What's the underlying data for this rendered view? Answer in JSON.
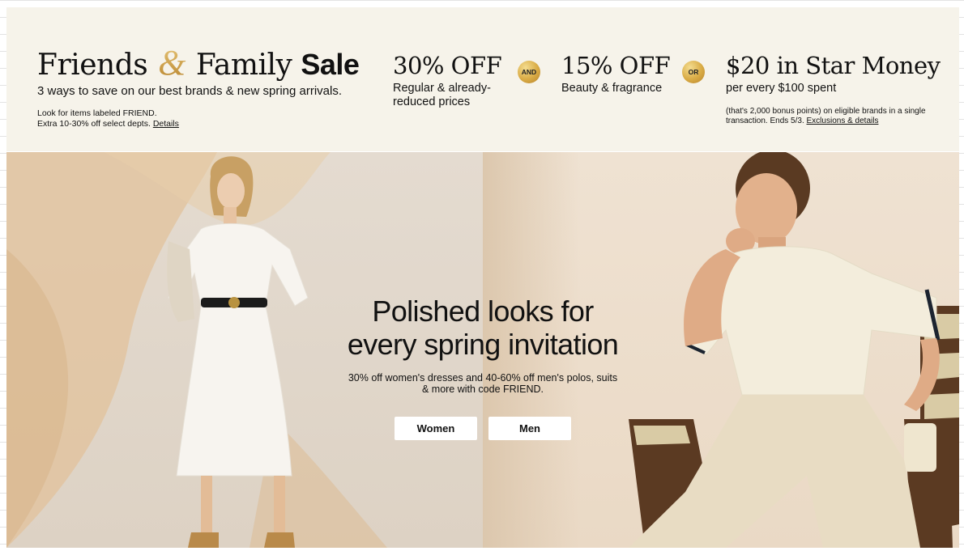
{
  "banner": {
    "title_part1": "Friends",
    "title_amp": "&",
    "title_part2": "Family",
    "title_sale": "Sale",
    "subtitle": "3 ways to save on our best brands & new spring arrivals.",
    "note_line1": "Look for items labeled FRIEND.",
    "note_line2": "Extra 10-30% off select depts.",
    "note_link": "Details",
    "offers": [
      {
        "headline": "30% OFF",
        "desc_line1": "Regular & already-",
        "desc_line2": "reduced prices"
      },
      {
        "headline": "15% OFF",
        "desc_line1": "Beauty & fragrance"
      },
      {
        "headline": "$20 in Star Money",
        "desc_line1": "per every $100 spent"
      }
    ],
    "coin_and": "AND",
    "coin_or": "OR",
    "fine_print": "(that's 2,000 bonus points) on eligible brands in a single transaction. Ends 5/3.",
    "fine_link": "Exclusions & details",
    "colors": {
      "background": "#f6f3ea",
      "gold": "#d4a63f"
    }
  },
  "hero": {
    "headline_line1": "Polished looks for",
    "headline_line2": "every spring invitation",
    "body_line1": "30% off women's dresses and 40-60% off men's polos, suits",
    "body_line2": "& more with code FRIEND.",
    "buttons": {
      "women": "Women",
      "men": "Men"
    },
    "images": {
      "left": "woman-white-dress-photo",
      "right": "man-cream-polo-photo"
    }
  }
}
